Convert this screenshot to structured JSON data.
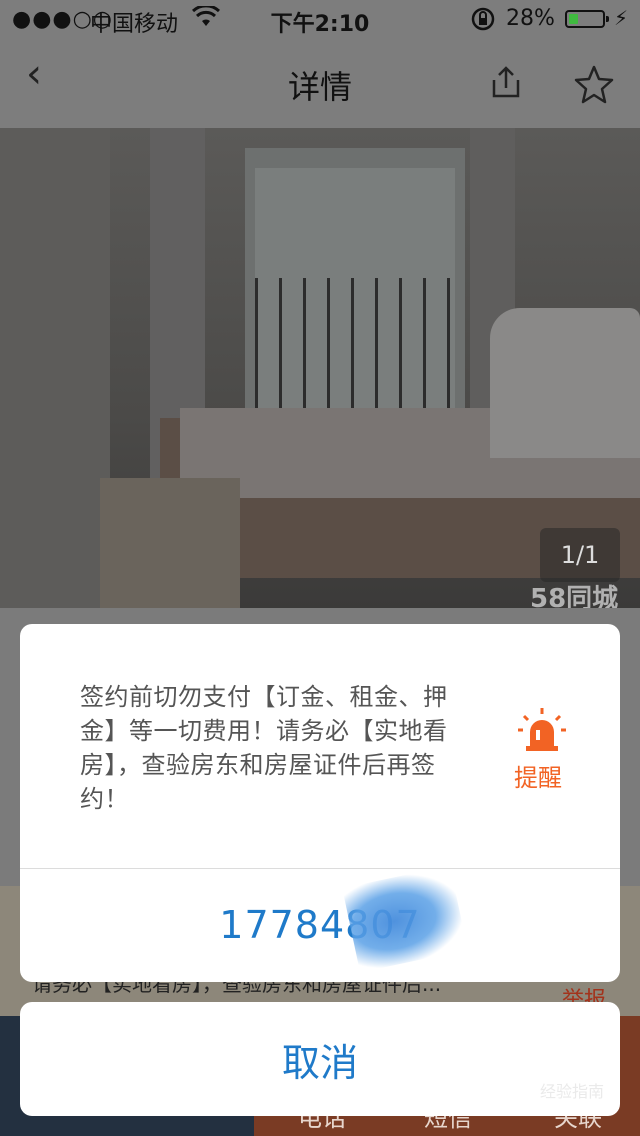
{
  "status_bar": {
    "signal": "●●●○○",
    "carrier": "中国移动",
    "wifi_icon": "wifi-icon",
    "time": "下午2:10",
    "battery_percent": "28%",
    "battery_level": 0.28,
    "battery_color": "#3fb93f"
  },
  "nav": {
    "back_icon": "‹",
    "title": "详情",
    "share_icon": "share-icon",
    "favorite_icon": "star-icon"
  },
  "photo": {
    "counter": "1/1",
    "watermark": "58同城"
  },
  "background_page": {
    "notice_line": "请务必【实地看房】，查验房东和房屋证件后...",
    "report_label": "举报",
    "bottom_labels": [
      "电话",
      "短信",
      "关联"
    ]
  },
  "dialog": {
    "message": "签约前切勿支付【订金、租金、押金】等一切费用！请务必【实地看房】，查验房东和房屋证件后再签约！",
    "remind_label": "提醒",
    "remind_color": "#f26324",
    "phone_number": "17784807"
  },
  "cancel_label": "取消",
  "accent_color": "#1f7ac9",
  "corner_watermark": "经验指南"
}
